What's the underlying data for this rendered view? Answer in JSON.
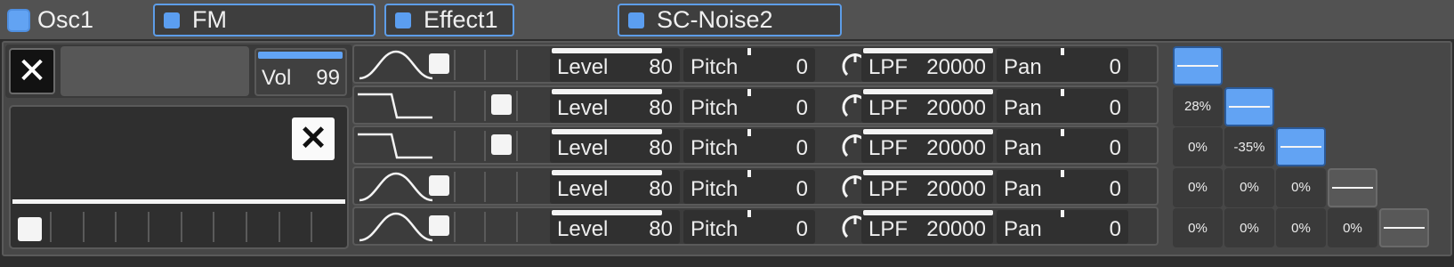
{
  "tabs": [
    {
      "label": "Osc1"
    },
    {
      "label": "FM"
    },
    {
      "label": "Effect1"
    },
    {
      "label": "SC-Noise2"
    }
  ],
  "left": {
    "close_glyph": "✕",
    "env_close_glyph": "✕",
    "vol_label": "Vol",
    "vol_value": "99",
    "vol_level": 0.99
  },
  "icons": {
    "close": "close-icon",
    "wave_sine": "sine-wave-icon",
    "wave_square": "square-step-wave-icon",
    "knob": "knob-icon"
  },
  "colors": {
    "accent": "#62a3f3",
    "background": "#2d2d2d",
    "panel": "#474747"
  },
  "rows": [
    {
      "wave": "sine",
      "level_label": "Level",
      "level": "80",
      "pitch_label": "Pitch",
      "pitch": "0",
      "lpf_label": "LPF",
      "lpf": "20000",
      "pan_label": "Pan",
      "pan": "0"
    },
    {
      "wave": "square",
      "level_label": "Level",
      "level": "80",
      "pitch_label": "Pitch",
      "pitch": "0",
      "lpf_label": "LPF",
      "lpf": "20000",
      "pan_label": "Pan",
      "pan": "0"
    },
    {
      "wave": "square",
      "level_label": "Level",
      "level": "80",
      "pitch_label": "Pitch",
      "pitch": "0",
      "lpf_label": "LPF",
      "lpf": "20000",
      "pan_label": "Pan",
      "pan": "0"
    },
    {
      "wave": "sine",
      "level_label": "Level",
      "level": "80",
      "pitch_label": "Pitch",
      "pitch": "0",
      "lpf_label": "LPF",
      "lpf": "20000",
      "pan_label": "Pan",
      "pan": "0"
    },
    {
      "wave": "sine",
      "level_label": "Level",
      "level": "80",
      "pitch_label": "Pitch",
      "pitch": "0",
      "lpf_label": "LPF",
      "lpf": "20000",
      "pan_label": "Pan",
      "pan": "0"
    }
  ],
  "matrix": {
    "row1": [],
    "row2": [
      "28%"
    ],
    "row3": [
      "0%",
      "-35%"
    ],
    "row4": [
      "0%",
      "0%",
      "0%"
    ],
    "row5": [
      "0%",
      "0%",
      "0%",
      "0%"
    ]
  }
}
